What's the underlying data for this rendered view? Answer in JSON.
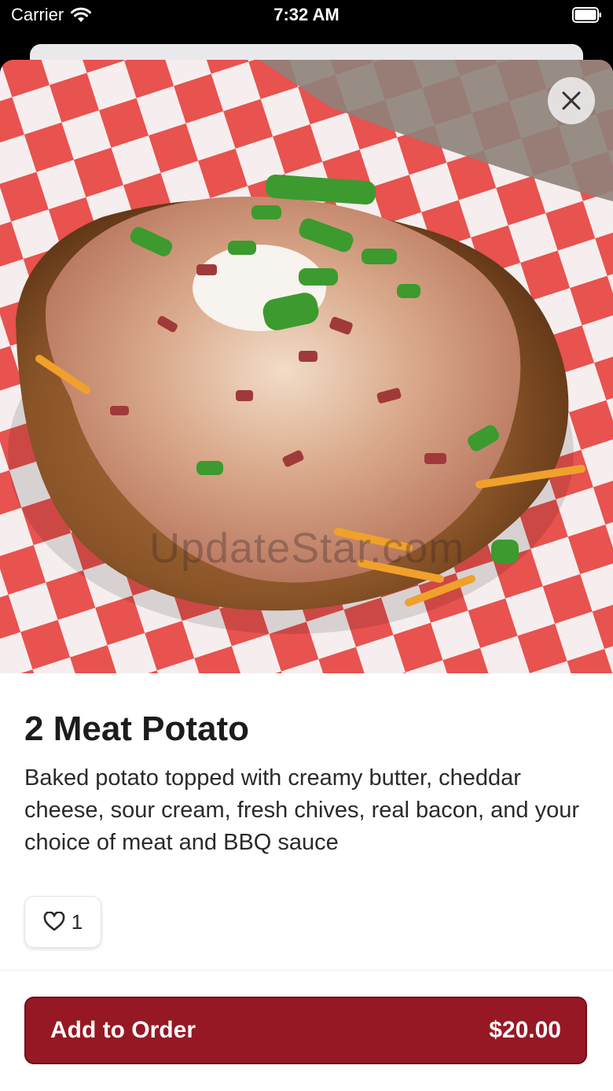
{
  "status_bar": {
    "carrier": "Carrier",
    "time": "7:32 AM"
  },
  "hero": {
    "image_description": "Baked potato topped with shredded chicken, bacon bits, cheddar, sour cream and chives in a red checkered paper-lined basket",
    "watermark": "UpdateStar.com"
  },
  "item": {
    "title": "2 Meat Potato",
    "description": "Baked potato topped with creamy butter, cheddar cheese, sour cream, fresh chives, real bacon, and your choice of meat and BBQ sauce",
    "likes": "1"
  },
  "footer": {
    "add_to_order_label": "Add to Order",
    "price": "$20.00"
  },
  "colors": {
    "accent": "#961824",
    "checker_red": "#e8524f",
    "text_primary": "#1c1c1e"
  },
  "icons": {
    "wifi": "wifi-icon",
    "battery": "battery-icon",
    "close": "close-icon",
    "heart": "heart-icon"
  }
}
